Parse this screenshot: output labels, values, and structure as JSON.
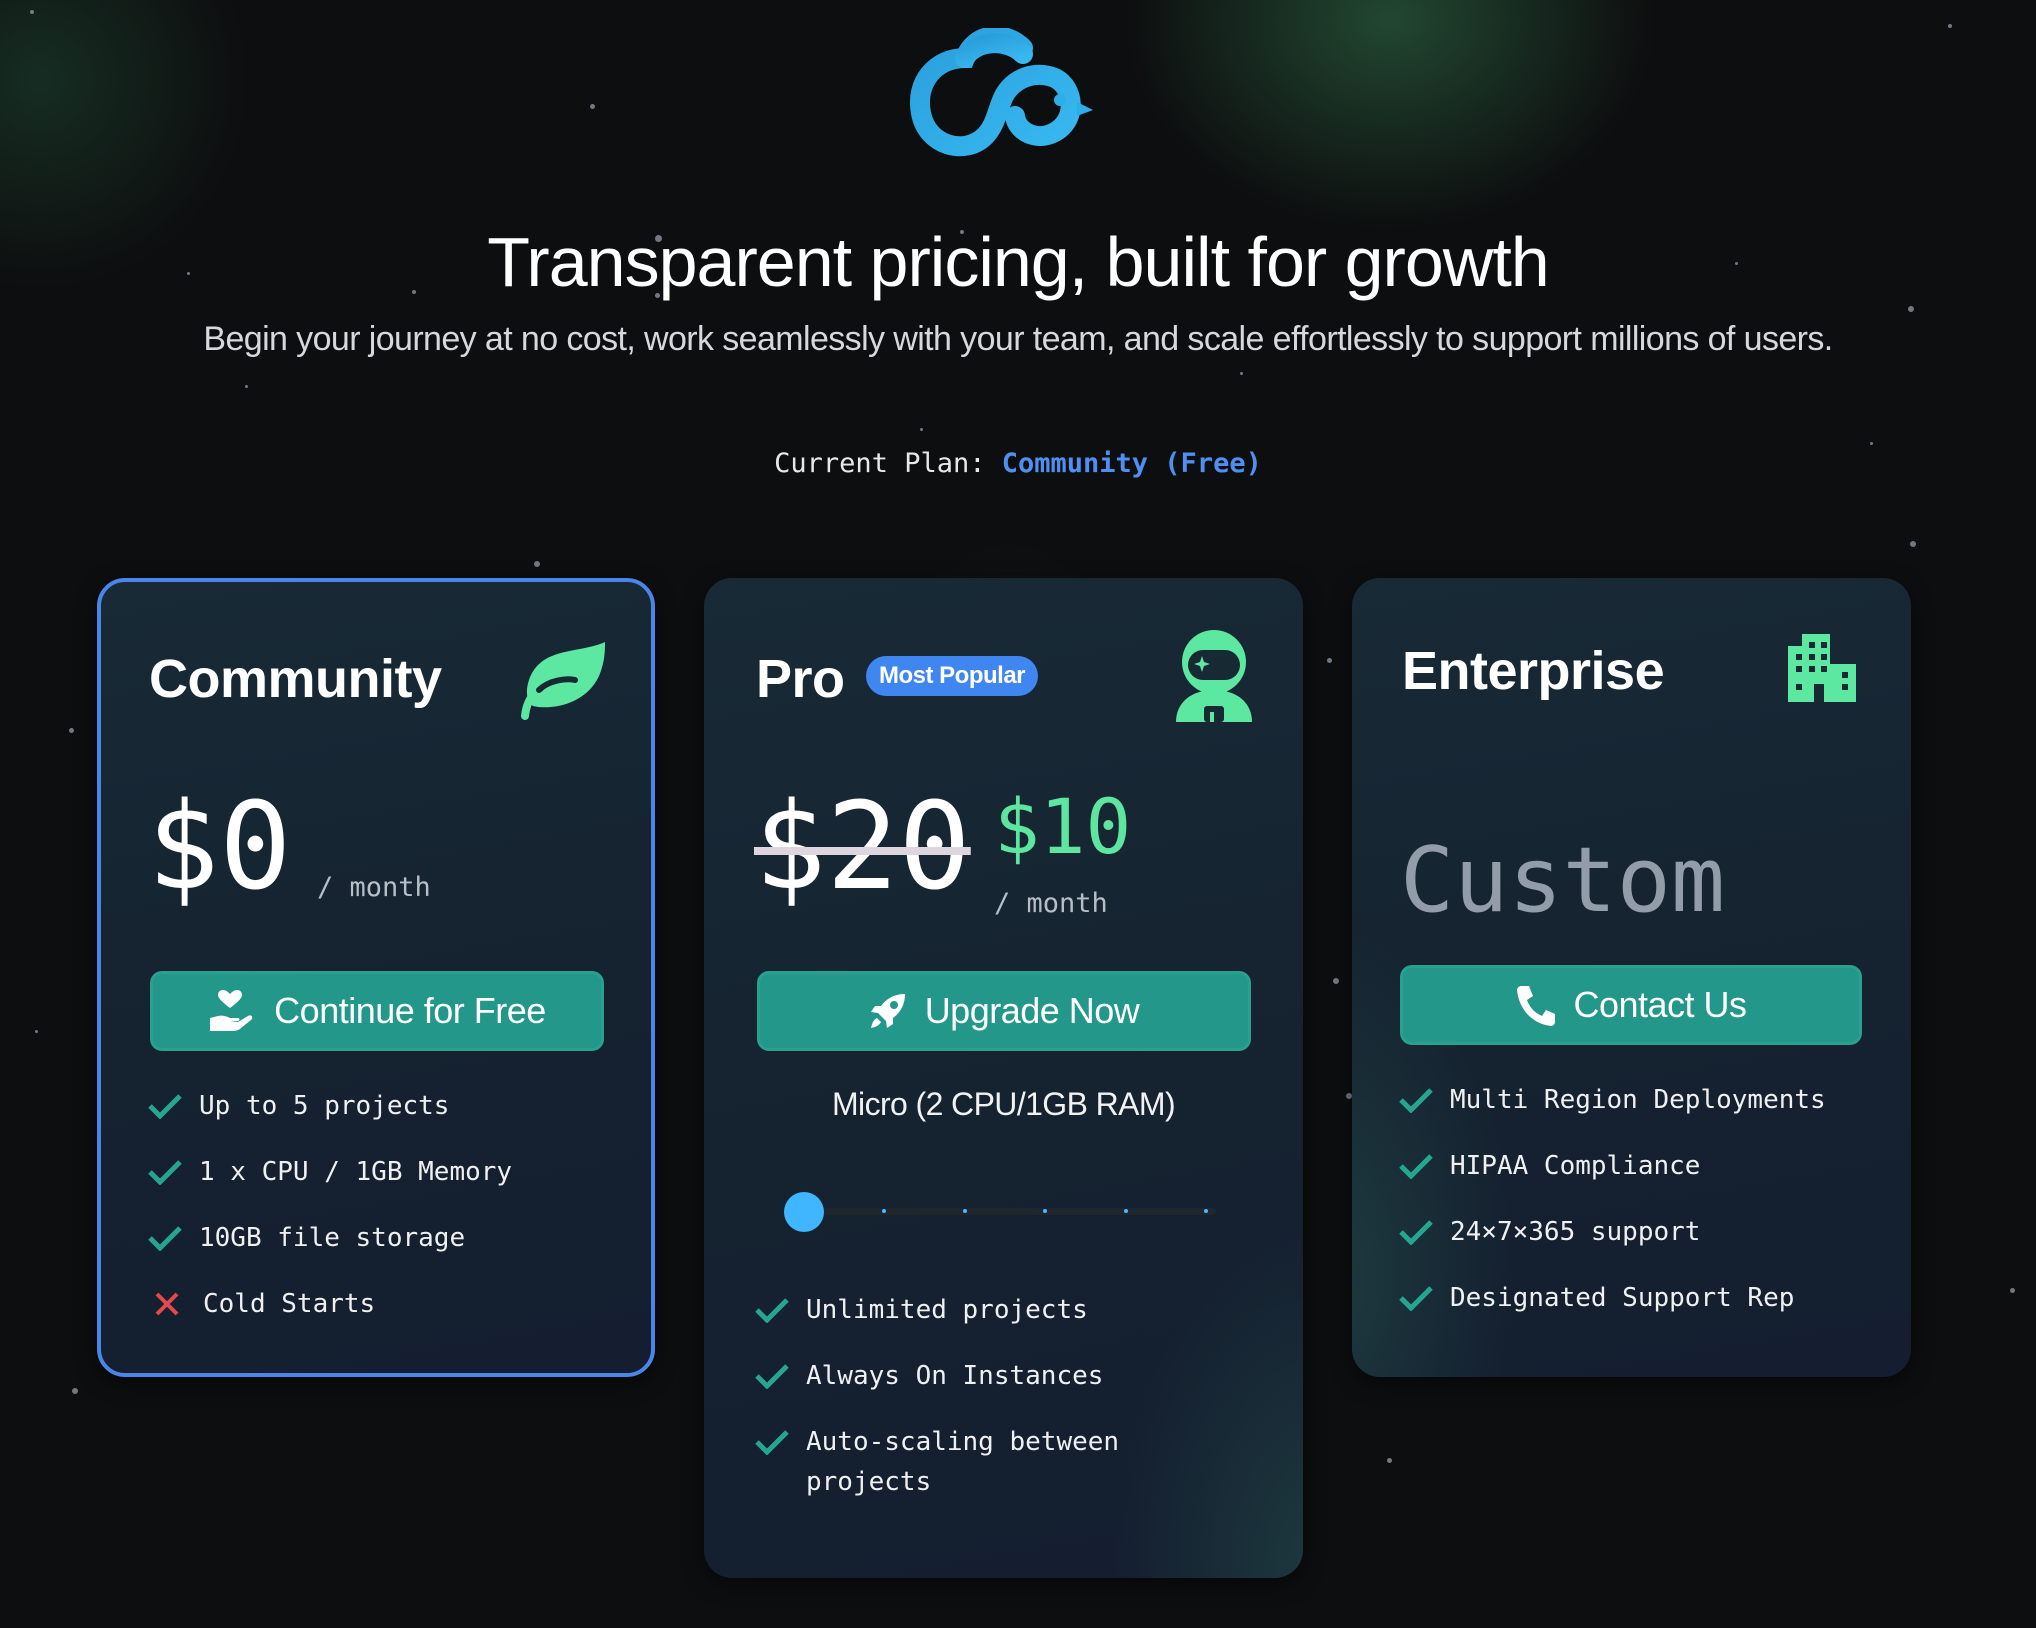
{
  "brand": {
    "logo_icon": "cloud-bird-logo-icon",
    "accent": "#2eaee8"
  },
  "header": {
    "title": "Transparent pricing, built for growth",
    "subtitle": "Begin your journey at no cost, work seamlessly with your team, and scale effortlessly to support millions of users."
  },
  "current_plan": {
    "label": "Current Plan:",
    "value": "Community (Free)"
  },
  "colors": {
    "cta": "#23988a",
    "check": "#26a590",
    "cross": "#e5484d",
    "price_new": "#5ee6a0",
    "badge": "#3f86f0",
    "selected_border": "#4a86ea"
  },
  "plans": {
    "community": {
      "name": "Community",
      "icon": "leaf-icon",
      "price": "$0",
      "period": "/ month",
      "cta": {
        "label": "Continue for Free",
        "icon": "hand-heart-icon"
      },
      "features": [
        {
          "text": "Up to 5 projects",
          "included": true
        },
        {
          "text": "1 x CPU / 1GB Memory",
          "included": true
        },
        {
          "text": "10GB file storage",
          "included": true
        },
        {
          "text": "Cold Starts",
          "included": false
        }
      ]
    },
    "pro": {
      "name": "Pro",
      "badge": "Most Popular",
      "icon": "astronaut-icon",
      "price_old": "$20",
      "price_new": "$10",
      "period": "/ month",
      "cta": {
        "label": "Upgrade Now",
        "icon": "rocket-icon"
      },
      "tier": {
        "label": "Micro (2 CPU/1GB RAM)",
        "slider_position": 0,
        "slider_steps": 6
      },
      "features": [
        {
          "text": "Unlimited projects",
          "included": true
        },
        {
          "text": "Always On Instances",
          "included": true
        },
        {
          "text": "Auto-scaling between projects",
          "included": true
        }
      ]
    },
    "enterprise": {
      "name": "Enterprise",
      "icon": "building-icon",
      "price": "Custom",
      "cta": {
        "label": "Contact Us",
        "icon": "phone-icon"
      },
      "features": [
        {
          "text": "Multi Region Deployments",
          "included": true
        },
        {
          "text": "HIPAA Compliance",
          "included": true
        },
        {
          "text": "24×7×365 support",
          "included": true
        },
        {
          "text": "Designated Support Rep",
          "included": true
        }
      ]
    }
  }
}
